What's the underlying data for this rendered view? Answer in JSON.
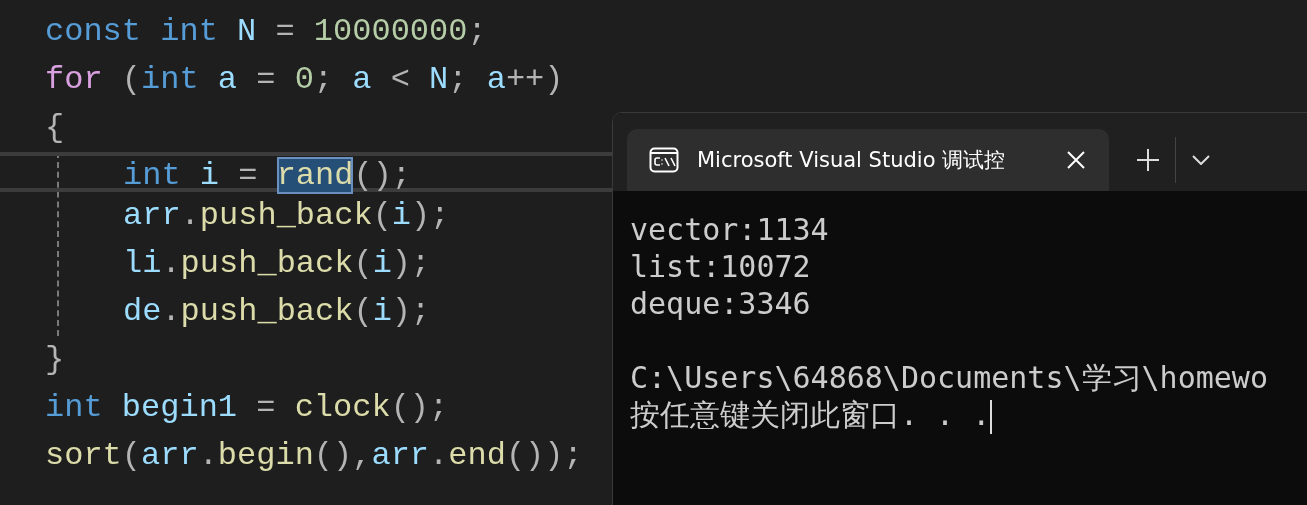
{
  "editor": {
    "lines": [
      {
        "tokens": [
          {
            "kind": "keyword",
            "text": "const int "
          },
          {
            "kind": "variable",
            "text": "N"
          },
          {
            "kind": "punct",
            "text": " = "
          },
          {
            "kind": "number",
            "text": "10000000"
          },
          {
            "kind": "punct",
            "text": ";"
          }
        ]
      },
      {
        "tokens": [
          {
            "kind": "control",
            "text": "for"
          },
          {
            "kind": "punct",
            "text": " ("
          },
          {
            "kind": "keyword",
            "text": "int "
          },
          {
            "kind": "variable",
            "text": "a"
          },
          {
            "kind": "punct",
            "text": " = "
          },
          {
            "kind": "number",
            "text": "0"
          },
          {
            "kind": "punct",
            "text": "; "
          },
          {
            "kind": "variable",
            "text": "a"
          },
          {
            "kind": "punct",
            "text": " < "
          },
          {
            "kind": "variable",
            "text": "N"
          },
          {
            "kind": "punct",
            "text": "; "
          },
          {
            "kind": "variable",
            "text": "a"
          },
          {
            "kind": "punct",
            "text": "++)"
          }
        ]
      },
      {
        "tokens": [
          {
            "kind": "punct",
            "text": "{"
          }
        ],
        "children": [
          {
            "current": true,
            "tokens": [
              {
                "kind": "keyword",
                "text": "int "
              },
              {
                "kind": "variable",
                "text": "i"
              },
              {
                "kind": "punct",
                "text": " = "
              },
              {
                "kind": "function",
                "text": "rand",
                "selected": true
              },
              {
                "kind": "punct",
                "text": "();"
              }
            ]
          },
          {
            "tokens": [
              {
                "kind": "variable",
                "text": "arr"
              },
              {
                "kind": "punct",
                "text": "."
              },
              {
                "kind": "function",
                "text": "push_back"
              },
              {
                "kind": "punct",
                "text": "("
              },
              {
                "kind": "variable",
                "text": "i"
              },
              {
                "kind": "punct",
                "text": ");"
              }
            ]
          },
          {
            "tokens": [
              {
                "kind": "variable",
                "text": "li"
              },
              {
                "kind": "punct",
                "text": "."
              },
              {
                "kind": "function",
                "text": "push_back"
              },
              {
                "kind": "punct",
                "text": "("
              },
              {
                "kind": "variable",
                "text": "i"
              },
              {
                "kind": "punct",
                "text": ");"
              }
            ]
          },
          {
            "tokens": [
              {
                "kind": "variable",
                "text": "de"
              },
              {
                "kind": "punct",
                "text": "."
              },
              {
                "kind": "function",
                "text": "push_back"
              },
              {
                "kind": "punct",
                "text": "("
              },
              {
                "kind": "variable",
                "text": "i"
              },
              {
                "kind": "punct",
                "text": ");"
              }
            ]
          }
        ]
      },
      {
        "tokens": [
          {
            "kind": "punct",
            "text": "}"
          }
        ]
      },
      {
        "tokens": [
          {
            "kind": "keyword",
            "text": "int "
          },
          {
            "kind": "variable",
            "text": "begin1"
          },
          {
            "kind": "punct",
            "text": " = "
          },
          {
            "kind": "function",
            "text": "clock"
          },
          {
            "kind": "punct",
            "text": "();"
          }
        ]
      },
      {
        "tokens": [
          {
            "kind": "function",
            "text": "sort"
          },
          {
            "kind": "punct",
            "text": "("
          },
          {
            "kind": "variable",
            "text": "arr"
          },
          {
            "kind": "punct",
            "text": "."
          },
          {
            "kind": "function",
            "text": "begin"
          },
          {
            "kind": "punct",
            "text": "(),"
          },
          {
            "kind": "variable",
            "text": "arr"
          },
          {
            "kind": "punct",
            "text": "."
          },
          {
            "kind": "function",
            "text": "end"
          },
          {
            "kind": "punct",
            "text": "());"
          }
        ]
      }
    ]
  },
  "terminal": {
    "tab": {
      "title": "Microsoft Visual Studio 调试控",
      "selected": true
    },
    "output_blocks": [
      [
        "vector:1134",
        "list:10072",
        "deque:3346"
      ],
      [
        "C:\\Users\\64868\\Documents\\学习\\homewo",
        "按任意键关闭此窗口. . ."
      ]
    ]
  }
}
